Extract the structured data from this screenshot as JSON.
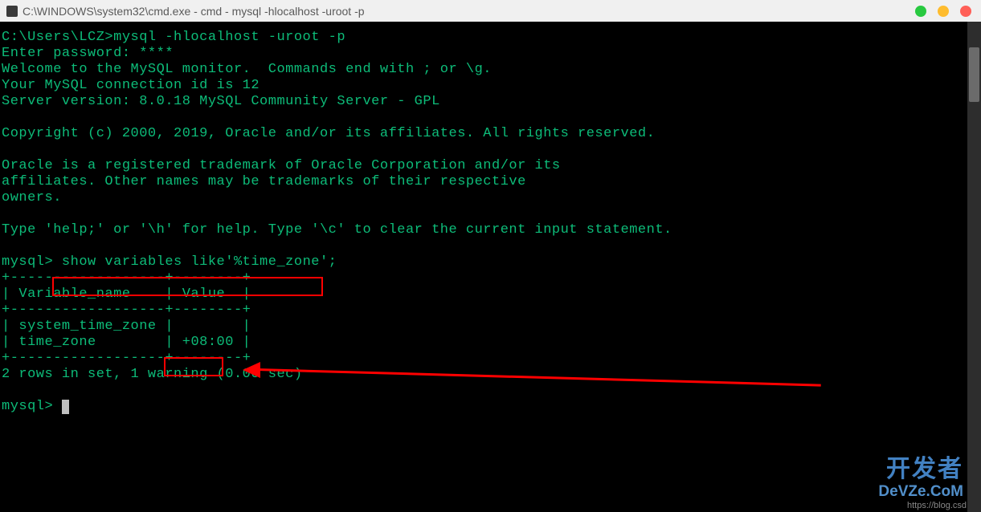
{
  "titlebar": {
    "title": "C:\\WINDOWS\\system32\\cmd.exe - cmd - mysql  -hlocalhost -uroot -p"
  },
  "terminal": {
    "line1": "C:\\Users\\LCZ>mysql -hlocalhost -uroot -p",
    "line2": "Enter password: ****",
    "line3": "Welcome to the MySQL monitor.  Commands end with ; or \\g.",
    "line4": "Your MySQL connection id is 12",
    "line5": "Server version: 8.0.18 MySQL Community Server - GPL",
    "line6": "",
    "line7": "Copyright (c) 2000, 2019, Oracle and/or its affiliates. All rights reserved.",
    "line8": "",
    "line9": "Oracle is a registered trademark of Oracle Corporation and/or its",
    "line10": "affiliates. Other names may be trademarks of their respective",
    "line11": "owners.",
    "line12": "",
    "line13": "Type 'help;' or '\\h' for help. Type '\\c' to clear the current input statement.",
    "line14": "",
    "prompt1": "mysql> ",
    "command1": "show variables like'%time_zone';",
    "table": {
      "border_top": "+------------------+--------+",
      "header": "| Variable_name    | Value  |",
      "border_mid": "+------------------+--------+",
      "row1": "| system_time_zone |        |",
      "row2_var": "| time_zone        | ",
      "row2_val": "+08:00",
      "row2_end": " |",
      "border_bot": "+------------------+--------+"
    },
    "result": "2 rows in set, 1 warning (0.00 sec)",
    "prompt2": "mysql> "
  },
  "watermark": {
    "cn": "开发者",
    "en": "DeVZe.CoM",
    "url": "https://blog.csd"
  }
}
